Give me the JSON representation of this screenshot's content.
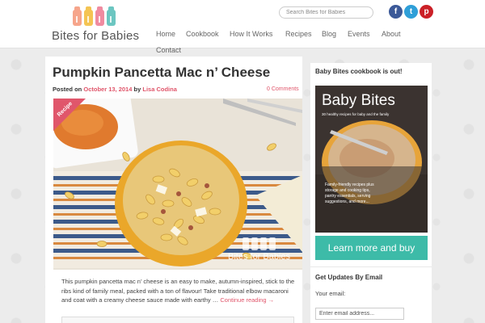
{
  "site": {
    "logo_text": "Bites for Babies"
  },
  "search": {
    "placeholder": "Search Bites for Babies"
  },
  "social": {
    "facebook": "f",
    "twitter": "t",
    "pinterest": "p"
  },
  "nav": {
    "items": [
      {
        "label": "Home"
      },
      {
        "label": "Cookbook"
      },
      {
        "label": "How It Works"
      },
      {
        "label": "Recipes"
      },
      {
        "label": "Blog"
      },
      {
        "label": "Events"
      },
      {
        "label": "About"
      },
      {
        "label": "Contact"
      }
    ]
  },
  "post": {
    "title": "Pumpkin Pancetta Mac n’ Cheese",
    "posted_on_label": "Posted on",
    "date": "October 13, 2014",
    "by_label": "by",
    "author": "Lisa Codina",
    "comments": "0 Comments",
    "ribbon": "Recipe",
    "watermark": "Bites for Babies",
    "excerpt": "This pumpkin pancetta mac n’ cheese is an easy to make, autumn-inspired, stick to the ribs kind of family meal, packed with a ton of flavour! Take traditional elbow macaroni and coat with a creamy cheese sauce made with earthy …",
    "continue_reading": "Continue reading →"
  },
  "sidebar": {
    "cookbook_title": "Baby Bites cookbook is out!",
    "book": {
      "title": "Baby Bites",
      "subtitle": "30 healthy recipes for baby and the family",
      "blurb": "Family-friendly recipes plus storage and cooking tips, pantry essentials, serving suggestions, and more..."
    },
    "cta_label": "Learn more and buy",
    "updates_title": "Get Updates By Email",
    "email_label": "Your email:",
    "email_placeholder": "Enter email address..."
  },
  "colors": {
    "accent": "#e0566b",
    "teal": "#3dbba8",
    "facebook": "#3b5998",
    "twitter": "#2f9fd8",
    "pinterest": "#cb2027"
  }
}
